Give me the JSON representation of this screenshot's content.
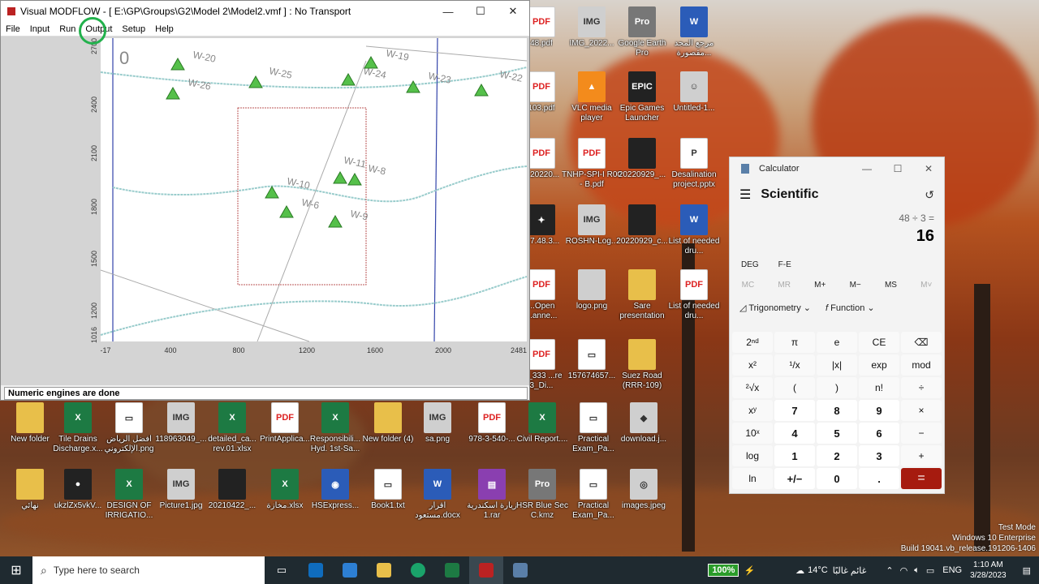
{
  "modflow": {
    "title": "Visual MODFLOW - [ E:\\GP\\Groups\\G2\\Model 2\\Model2.vmf ] : No Transport",
    "menu": [
      "File",
      "Input",
      "Run",
      "Output",
      "Setup",
      "Help"
    ],
    "status": "Numeric engines are done",
    "layer_label": "0",
    "y_ticks": [
      "2700",
      "2400",
      "2100",
      "1800",
      "1500",
      "1200",
      "1016"
    ],
    "x_ticks": [
      "-17",
      "400",
      "800",
      "1200",
      "1600",
      "2000",
      "2481"
    ],
    "wells": [
      "W-20",
      "W-26",
      "W-25",
      "W-24",
      "W-19",
      "W-23",
      "W-22",
      "W-11",
      "W-8",
      "W-10",
      "W-6",
      "W-9"
    ]
  },
  "desktop_icons": [
    {
      "label": "48.pdf",
      "type": "pdf",
      "g": "PDF"
    },
    {
      "label": "IMG_2022...",
      "type": "img",
      "g": "IMG"
    },
    {
      "label": "Google Earth Pro",
      "type": "ge",
      "g": "Pro"
    },
    {
      "label": "مرجع المجد مقصورة...",
      "type": "word",
      "g": "W"
    },
    {
      "label": "103.pdf",
      "type": "pdf",
      "g": "PDF"
    },
    {
      "label": "VLC media player",
      "type": "vlc",
      "g": "▲"
    },
    {
      "label": "Epic Games Launcher",
      "type": "dark",
      "g": "EPIC"
    },
    {
      "label": "Untitled-1...",
      "type": "img",
      "g": "☺"
    },
    {
      "label": "...20220...",
      "type": "pdf",
      "g": "PDF"
    },
    {
      "label": "TNHP-SPI-I R00 - B.pdf",
      "type": "pdf",
      "g": "PDF"
    },
    {
      "label": "20220929_...",
      "type": "dark",
      "g": ""
    },
    {
      "label": "Desalination project.pptx",
      "type": "doc",
      "g": "P"
    },
    {
      "label": "p.7.48.3...",
      "type": "dark",
      "g": "✦"
    },
    {
      "label": "ROSHN-Log...",
      "type": "img",
      "g": "IMG"
    },
    {
      "label": "20220929_c...",
      "type": "dark",
      "g": ""
    },
    {
      "label": "List of needed dru...",
      "type": "word",
      "g": "W"
    },
    {
      "label": "...Open ...anne...",
      "type": "pdf",
      "g": "PDF"
    },
    {
      "label": "logo.png",
      "type": "img",
      "g": ""
    },
    {
      "label": "Sare presentation",
      "type": "folder",
      "g": ""
    },
    {
      "label": "List of needed dru...",
      "type": "pdf",
      "g": "PDF"
    },
    {
      "label": "El_333 ...re 3_Di...",
      "type": "pdf",
      "g": "PDF"
    },
    {
      "label": "157674657...",
      "type": "doc",
      "g": "▭"
    },
    {
      "label": "Suez Road (RRR-109)",
      "type": "folder",
      "g": ""
    },
    {
      "label": "New folder",
      "type": "folder",
      "g": ""
    },
    {
      "label": "Tile Drains Discharge.x...",
      "type": "xls",
      "g": "X"
    },
    {
      "label": "أفضل الرياض الإلكتروني.png",
      "type": "doc",
      "g": "▭"
    },
    {
      "label": "118963049_...",
      "type": "img",
      "g": "IMG"
    },
    {
      "label": "detailed_ca... rev.01.xlsx",
      "type": "xls",
      "g": "X"
    },
    {
      "label": "PrintApplica...",
      "type": "pdf",
      "g": "PDF"
    },
    {
      "label": "Responsibili... Hyd. 1st-Sa...",
      "type": "xls",
      "g": "X"
    },
    {
      "label": "New folder (4)",
      "type": "folder",
      "g": ""
    },
    {
      "label": "sa.png",
      "type": "img",
      "g": "IMG"
    },
    {
      "label": "978-3-540-...",
      "type": "pdf",
      "g": "PDF"
    },
    {
      "label": "Civil Report....",
      "type": "xls",
      "g": "X"
    },
    {
      "label": "Practical Exam_Pa...",
      "type": "doc",
      "g": "▭"
    },
    {
      "label": "download.j...",
      "type": "img",
      "g": "◆"
    },
    {
      "label": "نهائي",
      "type": "folder",
      "g": ""
    },
    {
      "label": "ukzlZx5vkV...",
      "type": "dark",
      "g": "●"
    },
    {
      "label": "DESIGN OF IRRIGATIO...",
      "type": "xls",
      "g": "X"
    },
    {
      "label": "Picture1.jpg",
      "type": "img",
      "g": "IMG"
    },
    {
      "label": "20210422_...",
      "type": "dark",
      "g": ""
    },
    {
      "label": "مخازة.xlsx",
      "type": "xls",
      "g": "X"
    },
    {
      "label": "HSExpress...",
      "type": "word",
      "g": "◉"
    },
    {
      "label": "Book1.txt",
      "type": "doc",
      "g": "▭"
    },
    {
      "label": "اقرار مستعود.docx",
      "type": "word",
      "g": "W"
    },
    {
      "label": "زيارة اسكندرية 1.rar",
      "type": "rar",
      "g": "▤"
    },
    {
      "label": "HSR Blue Sec C.kmz",
      "type": "ge",
      "g": "Pro"
    },
    {
      "label": "Practical Exam_Pa...",
      "type": "doc",
      "g": "▭"
    },
    {
      "label": "images.jpeg",
      "type": "img",
      "g": "◎"
    }
  ],
  "calculator": {
    "title": "Calculator",
    "mode": "Scientific",
    "expression": "48 ÷ 3 =",
    "result": "16",
    "deg": "DEG",
    "fe": "F-E",
    "memory": [
      "MC",
      "MR",
      "M+",
      "M−",
      "MS",
      "M˅"
    ],
    "trig": "Trigonometry",
    "function": "Function",
    "keys": [
      "2ⁿᵈ",
      "π",
      "e",
      "CE",
      "⌫",
      "x²",
      "¹/x",
      "|x|",
      "exp",
      "mod",
      "²√x",
      "(",
      ")",
      "n!",
      "÷",
      "xʸ",
      "7",
      "8",
      "9",
      "×",
      "10ˣ",
      "4",
      "5",
      "6",
      "−",
      "log",
      "1",
      "2",
      "3",
      "+",
      "ln",
      "+/−",
      "0",
      ".",
      "="
    ]
  },
  "taskbar": {
    "search_placeholder": "Type here to search",
    "battery": "100%",
    "weather_temp": "14°C",
    "weather_text": "غائم غالبًا",
    "lang": "ENG",
    "time": "1:10 AM",
    "date": "3/28/2023"
  },
  "watermark": [
    "Test Mode",
    "Windows 10 Enterprise",
    "Build 19041.vb_release.191206-1406"
  ]
}
